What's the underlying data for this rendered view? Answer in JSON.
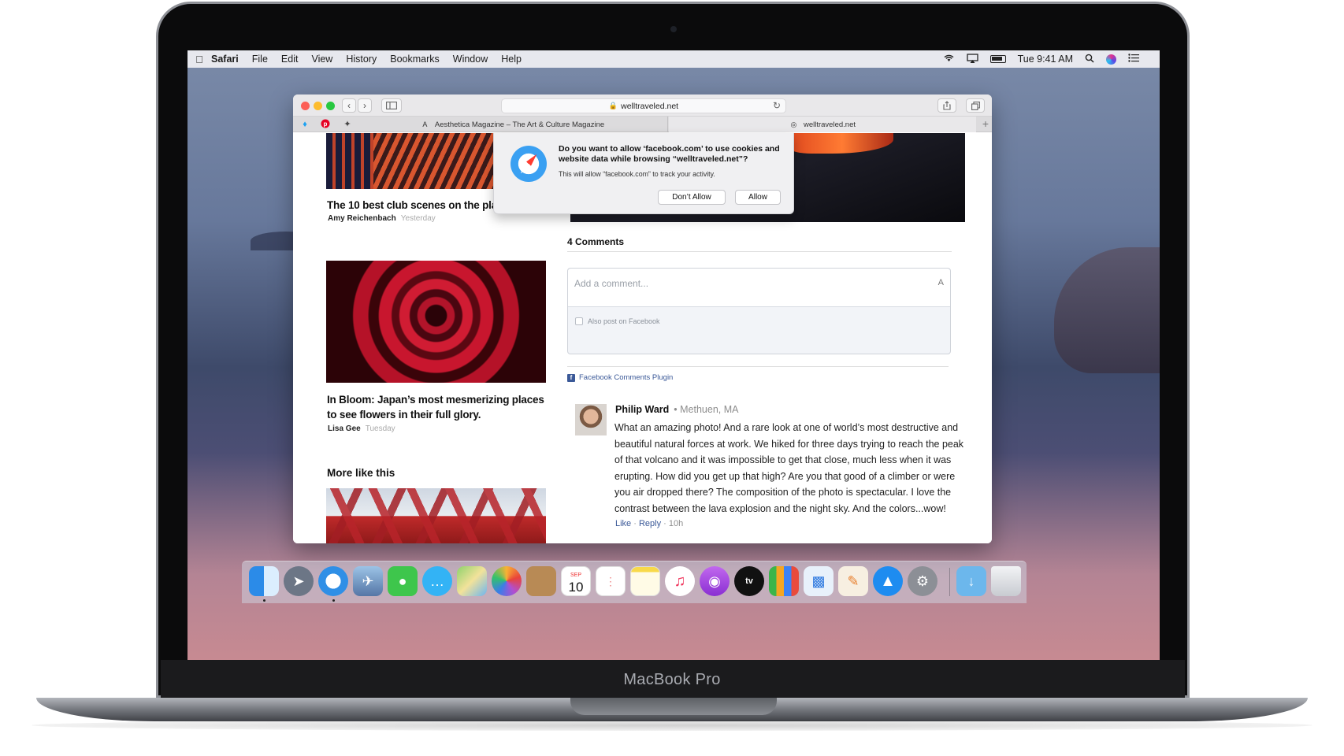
{
  "device": {
    "brand": "MacBook Pro"
  },
  "menubar": {
    "app": "Safari",
    "items": [
      "File",
      "Edit",
      "View",
      "History",
      "Bookmarks",
      "Window",
      "Help"
    ],
    "clock": "Tue 9:41 AM",
    "icons": [
      "wifi-icon",
      "airplay-icon",
      "battery-icon",
      "spotlight-icon",
      "siri-icon",
      "notification-center-icon"
    ]
  },
  "browser": {
    "url": "welltraveled.net",
    "tabs": [
      {
        "label": "Aesthetica Magazine – The Art & Culture Magazine",
        "icon": "A"
      },
      {
        "label": "welltraveled.net",
        "icon": "◎"
      }
    ],
    "pinned": [
      "twitter-icon",
      "pinterest-icon",
      "pin-icon"
    ]
  },
  "dialog": {
    "title": "Do you want to allow ‘facebook.com’ to use cookies and website data while browsing “welltraveled.net”?",
    "subtitle": "This will allow “facebook.com” to track your activity.",
    "deny_label": "Don’t Allow",
    "allow_label": "Allow"
  },
  "articles": [
    {
      "title": "The 10 best club scenes on the plar",
      "author": "Amy Reichenbach",
      "when": "Yesterday"
    },
    {
      "title": "In Bloom: Japan’s most mesmerizing places to see flowers in their full glory.",
      "author": "Lisa Gee",
      "when": "Tuesday"
    }
  ],
  "more_like_this": "More like this",
  "comments": {
    "heading": "4 Comments",
    "placeholder": "Add a comment...",
    "input_glyph": "A",
    "also_post": "Also post on Facebook",
    "plugin_label": "Facebook Comments Plugin",
    "plugin_glyph": "f",
    "entry": {
      "author": "Philip Ward",
      "location": "• Methuen, MA",
      "text": "What an amazing photo! And a rare look at one of world’s most destructive and beautiful natural forces at work. We hiked for three days trying to reach the peak of that volcano and it was impossible to get that close, much less when it was erupting. How did you get up that high? Are you that good of a climber or were you air dropped there? The composition of the photo is spectacular. I love the contrast between the lava explosion and the night sky. And the colors...wow!",
      "like": "Like",
      "reply": "Reply",
      "age": "· 10h"
    }
  },
  "dock": {
    "calendar_day": "10",
    "calendar_month": "SEP",
    "tv_label": "tv"
  }
}
